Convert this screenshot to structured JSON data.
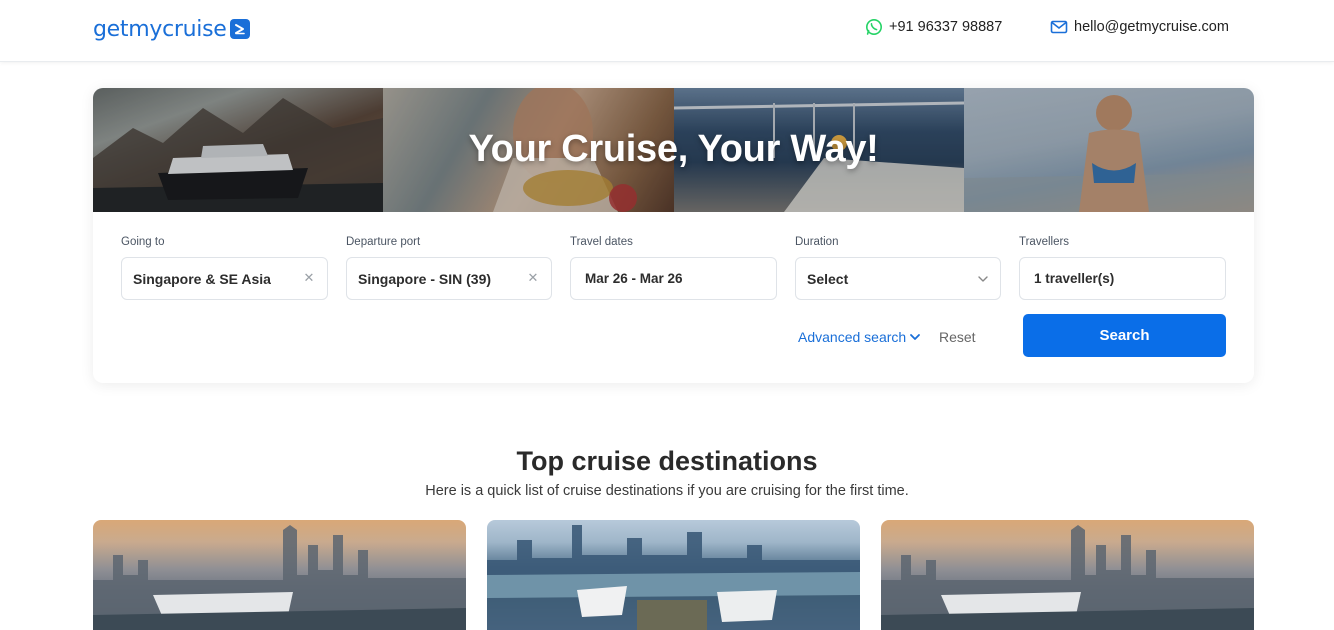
{
  "header": {
    "logo_text": "getmycruise",
    "phone": "+91 96337 98887",
    "email": "hello@getmycruise.com",
    "phone_icon": "whatsapp-icon",
    "email_icon": "envelope-icon"
  },
  "hero": {
    "title": "Your Cruise, Your Way!"
  },
  "search": {
    "fields": [
      {
        "label": "Going to",
        "value": "Singapore & SE Asia"
      },
      {
        "label": "Departure port",
        "value": "Singapore - SIN (39)"
      },
      {
        "label": "Travel dates",
        "value": "Mar 26 - Mar 26"
      },
      {
        "label": "Duration",
        "value": "Select"
      },
      {
        "label": "Travellers",
        "value": "1 traveller(s)"
      }
    ],
    "advanced_label": "Advanced search",
    "reset_label": "Reset",
    "search_label": "Search"
  },
  "destinations": {
    "title": "Top cruise destinations",
    "subtitle": "Here is a quick list of cruise destinations if you are cruising for the first time."
  },
  "colors": {
    "brand": "#1a6fd8",
    "button": "#0a6ee8",
    "whatsapp": "#25d366"
  }
}
